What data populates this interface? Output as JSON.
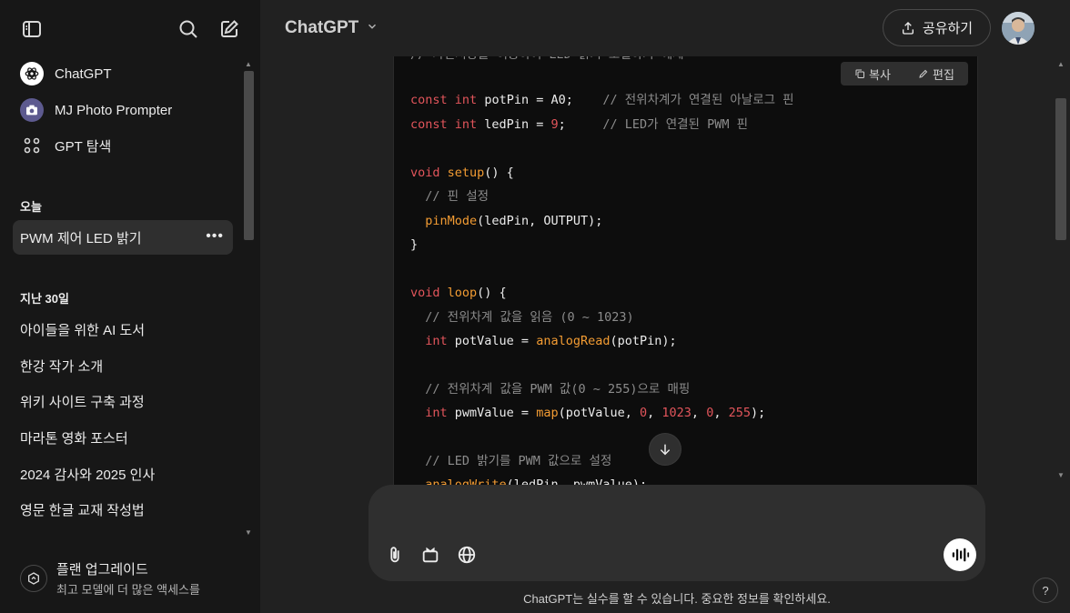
{
  "sidebar": {
    "nav": [
      {
        "label": "ChatGPT",
        "icon": "openai-logo-icon"
      },
      {
        "label": "MJ Photo Prompter",
        "icon": "camera-gpt-icon"
      },
      {
        "label": "GPT 탐색",
        "icon": "grid-dots-icon"
      }
    ],
    "today_label": "오늘",
    "today_chats": [
      {
        "label": "PWM 제어 LED 밝기",
        "more": "•••"
      }
    ],
    "past30_label": "지난 30일",
    "past30_chats": [
      {
        "label": "아이들을 위한 AI 도서"
      },
      {
        "label": "한강 작가 소개"
      },
      {
        "label": "위키 사이트 구축 과정"
      },
      {
        "label": "마라톤 영화 포스터"
      },
      {
        "label": "2024 감사와 2025 인사"
      },
      {
        "label": "영문 한글 교재 작성법"
      }
    ],
    "upgrade": {
      "title": "플랜 업그레이드",
      "subtitle": "최고 모델에 더 많은 액세스를"
    }
  },
  "header": {
    "model_name": "ChatGPT",
    "share_label": "공유하기"
  },
  "code_block": {
    "copy_label": "복사",
    "edit_label": "편집",
    "top_partial_comment": "// 가변저항을 이용하여 LED 밝기 조절하기 예제"
  },
  "composer": {
    "placeholder": ""
  },
  "disclaimer": "ChatGPT는 실수를 할 수 있습니다. 중요한 정보를 확인하세요.",
  "help_label": "?",
  "colors": {
    "sidebar_bg": "#171717",
    "main_bg": "#212121",
    "code_bg": "#0d0d0d",
    "keyword": "#e2555b",
    "function": "#f39c33",
    "comment": "#8c8c8c"
  }
}
